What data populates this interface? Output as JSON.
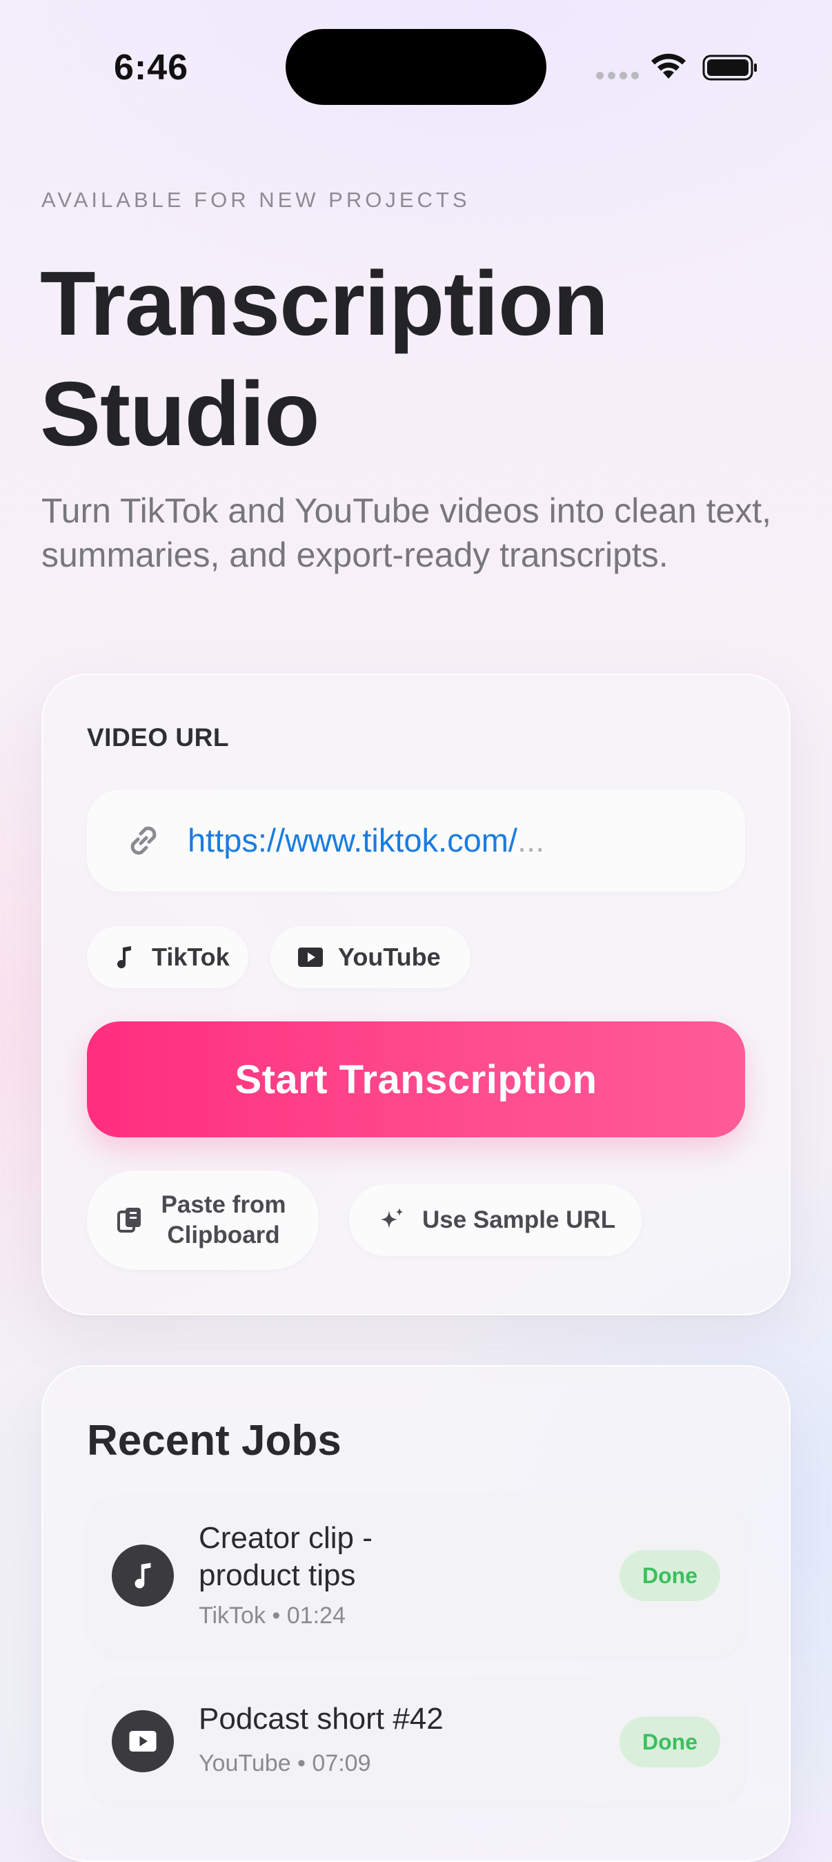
{
  "status_bar": {
    "time": "6:46"
  },
  "header": {
    "eyebrow": "AVAILABLE FOR NEW PROJECTS",
    "title_line1": "Transcription",
    "title_line2": "Studio",
    "subtitle": "Turn TikTok and YouTube videos into clean text, summaries, and export-ready transcripts."
  },
  "input_card": {
    "field_label": "VIDEO URL",
    "url_value": "https://www.tiktok.com/",
    "url_ellipsis": "...",
    "chips": [
      {
        "label": "TikTok",
        "icon": "music-note-icon"
      },
      {
        "label": "YouTube",
        "icon": "youtube-play-icon"
      }
    ],
    "primary_button": "Start Transcription",
    "paste_button_line1": "Paste from",
    "paste_button_line2": "Clipboard",
    "sample_button": "Use Sample URL"
  },
  "recent_jobs": {
    "title": "Recent Jobs",
    "jobs": [
      {
        "title_line1": "Creator clip -",
        "title_line2": "product tips",
        "meta": "TikTok • 01:24",
        "status": "Done",
        "icon": "music-note-icon"
      },
      {
        "title_line1": "Podcast short #42",
        "meta": "YouTube • 07:09",
        "status": "Done",
        "icon": "youtube-play-icon"
      }
    ]
  },
  "colors": {
    "accent": "#ff3d86",
    "link": "#1a7ce0",
    "status_done_bg": "#d9efdc",
    "status_done_text": "#3cbf5d"
  }
}
